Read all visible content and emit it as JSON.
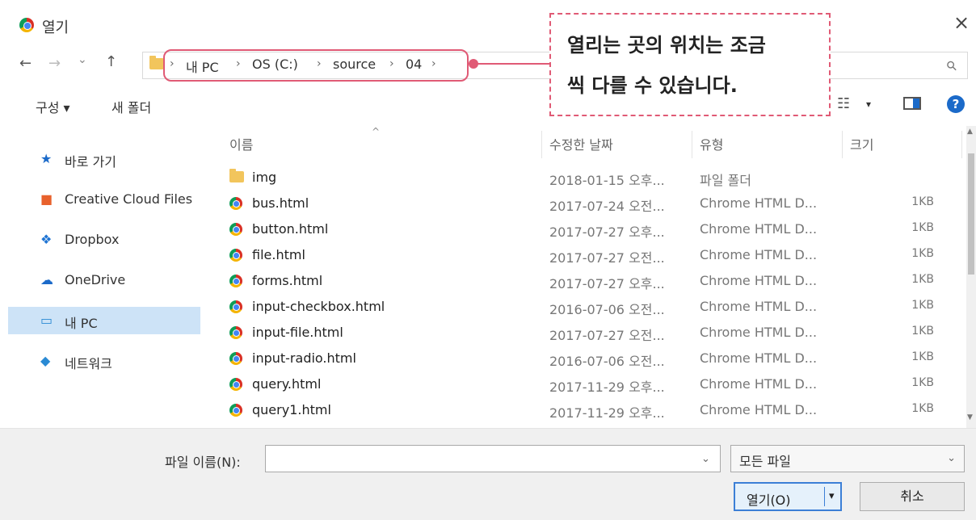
{
  "window": {
    "title": "열기",
    "close": "×"
  },
  "nav": {
    "back": "←",
    "forward": "→",
    "recent": "⌄",
    "up": "↑",
    "sep": "›",
    "crumbs": [
      "내 PC",
      "OS (C:)",
      "source",
      "04"
    ],
    "search_icon": "⚲"
  },
  "callout": {
    "line1": "열리는 곳의 위치는 조금",
    "line2": "씩 다를 수 있습니다."
  },
  "toolbar": {
    "organize": "구성 ▾",
    "new_folder": "새 폴더",
    "view_icon": "☷",
    "view_caret": "▾",
    "help": "?"
  },
  "sidebar": {
    "items": [
      {
        "label": "바로 가기",
        "icon": "pin-icon",
        "glyph": "★",
        "color": "#1b6ac9"
      },
      {
        "label": "Creative Cloud Files",
        "icon": "creative-cloud-icon",
        "glyph": "■",
        "color": "#e8612c"
      },
      {
        "label": "Dropbox",
        "icon": "dropbox-icon",
        "glyph": "❖",
        "color": "#1f74d3"
      },
      {
        "label": "OneDrive",
        "icon": "onedrive-icon",
        "glyph": "☁",
        "color": "#1b6ac9"
      },
      {
        "label": "내 PC",
        "icon": "computer-icon",
        "glyph": "▭",
        "color": "#2a8ad4",
        "selected": true
      },
      {
        "label": "네트워크",
        "icon": "network-icon",
        "glyph": "◆",
        "color": "#2a8ad4"
      }
    ]
  },
  "columns": {
    "name": "이름",
    "modified": "수정한 날짜",
    "type": "유형",
    "size": "크기",
    "sort_caret": "^"
  },
  "files": [
    {
      "name": "img",
      "date": "2018-01-15 오후...",
      "type": "파일 폴더",
      "size": "",
      "kind": "folder"
    },
    {
      "name": "bus.html",
      "date": "2017-07-24 오전...",
      "type": "Chrome HTML D...",
      "size": "1KB",
      "kind": "html"
    },
    {
      "name": "button.html",
      "date": "2017-07-27 오후...",
      "type": "Chrome HTML D...",
      "size": "1KB",
      "kind": "html"
    },
    {
      "name": "file.html",
      "date": "2017-07-27 오전...",
      "type": "Chrome HTML D...",
      "size": "1KB",
      "kind": "html"
    },
    {
      "name": "forms.html",
      "date": "2017-07-27 오후...",
      "type": "Chrome HTML D...",
      "size": "1KB",
      "kind": "html"
    },
    {
      "name": "input-checkbox.html",
      "date": "2016-07-06 오전...",
      "type": "Chrome HTML D...",
      "size": "1KB",
      "kind": "html"
    },
    {
      "name": "input-file.html",
      "date": "2017-07-27 오전...",
      "type": "Chrome HTML D...",
      "size": "1KB",
      "kind": "html"
    },
    {
      "name": "input-radio.html",
      "date": "2016-07-06 오전...",
      "type": "Chrome HTML D...",
      "size": "1KB",
      "kind": "html"
    },
    {
      "name": "query.html",
      "date": "2017-11-29 오후...",
      "type": "Chrome HTML D...",
      "size": "1KB",
      "kind": "html"
    },
    {
      "name": "query1.html",
      "date": "2017-11-29 오후...",
      "type": "Chrome HTML D...",
      "size": "1KB",
      "kind": "html"
    }
  ],
  "bottom": {
    "filename_label": "파일 이름(N):",
    "filename_value": "",
    "filename_caret": "⌄",
    "filter": "모든 파일",
    "filter_caret": "⌄",
    "open": "열기(O)",
    "open_caret": "▾",
    "cancel": "취소"
  },
  "scroll": {
    "up": "▲",
    "down": "▼"
  }
}
